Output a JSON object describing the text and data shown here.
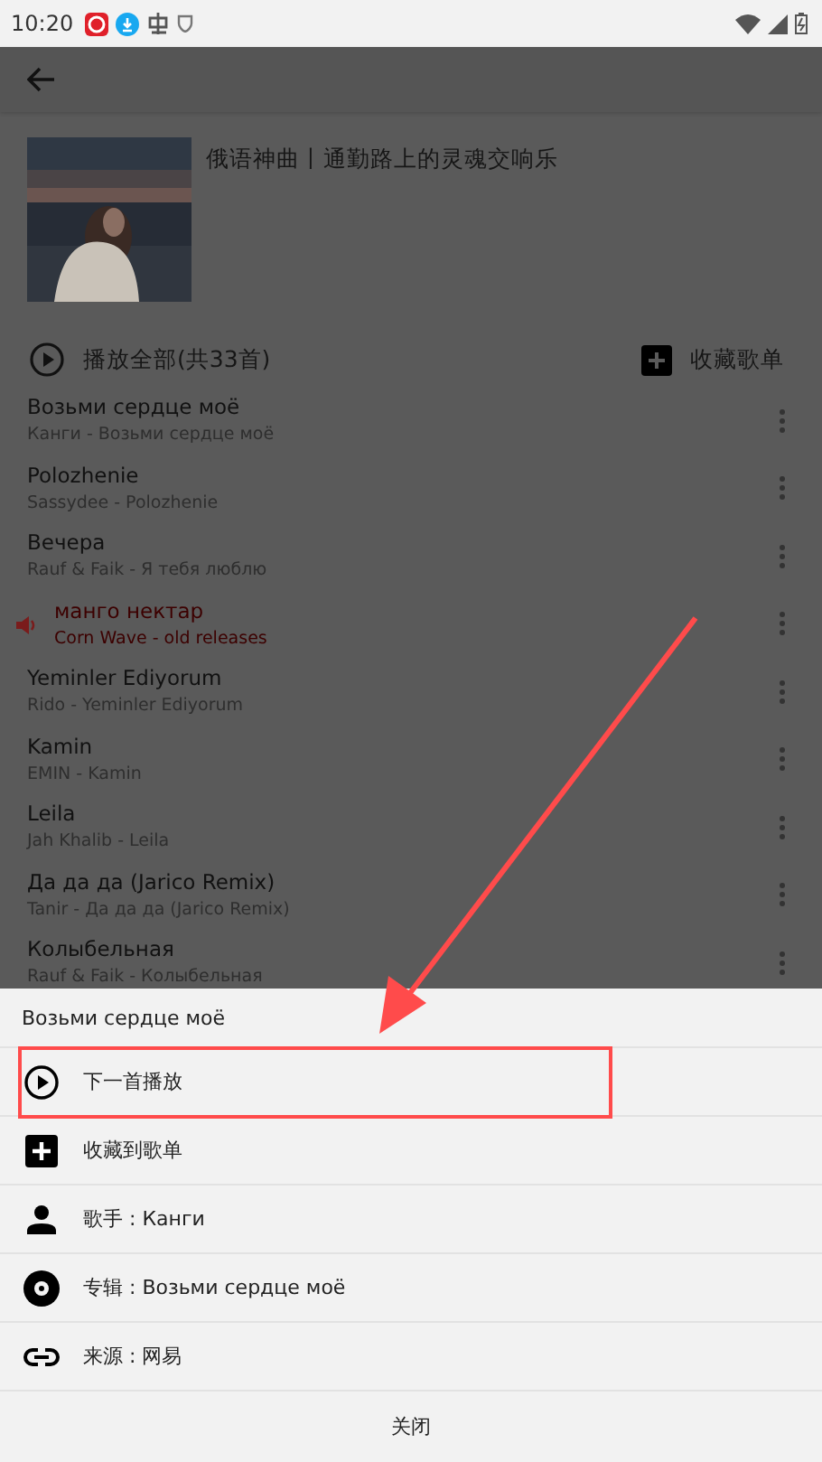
{
  "status_bar": {
    "time": "10:20"
  },
  "playlist": {
    "title": "俄语神曲丨通勤路上的灵魂交响乐",
    "play_all": "播放全部(共33首)",
    "collect": "收藏歌单"
  },
  "songs": [
    {
      "title": "Возьми сердце моё",
      "subtitle": "Канги - Возьми сердце моё",
      "playing": false
    },
    {
      "title": "Polozhenie",
      "subtitle": "Sassydee - Polozhenie",
      "playing": false
    },
    {
      "title": "Вечера",
      "subtitle": "Rauf & Faik - Я тебя люблю",
      "playing": false
    },
    {
      "title": "манго нектар",
      "subtitle": "Corn Wave - old releases",
      "playing": true
    },
    {
      "title": "Yeminler Ediyorum",
      "subtitle": "Rido - Yeminler Ediyorum",
      "playing": false
    },
    {
      "title": "Kamin",
      "subtitle": "EMIN - Kamin",
      "playing": false
    },
    {
      "title": "Leila",
      "subtitle": "Jah Khalib - Leila",
      "playing": false
    },
    {
      "title": "Да да да (Jarico Remix)",
      "subtitle": "Tanir - Да да да (Jarico Remix)",
      "playing": false
    },
    {
      "title": "Колыбельная",
      "subtitle": "Rauf & Faik - Колыбельная",
      "playing": false
    }
  ],
  "sheet": {
    "title": "Возьми сердце моё",
    "actions": [
      {
        "kind": "play",
        "label": "下一首播放",
        "highlighted": true
      },
      {
        "kind": "add",
        "label": "收藏到歌单",
        "highlighted": false
      },
      {
        "kind": "artist",
        "label": "歌手 : Канги",
        "highlighted": false
      },
      {
        "kind": "album",
        "label": "专辑 : Возьми сердце моё",
        "highlighted": false
      },
      {
        "kind": "source",
        "label": "来源 : 网易",
        "highlighted": false
      }
    ],
    "close": "关闭"
  }
}
